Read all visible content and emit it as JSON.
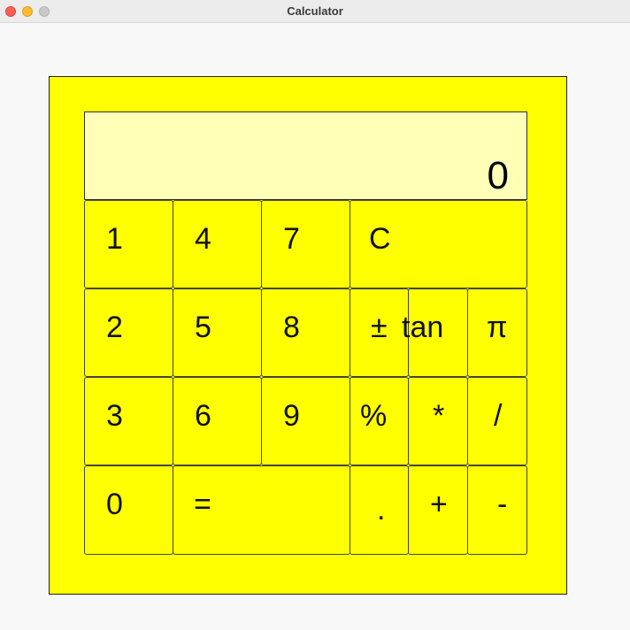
{
  "window": {
    "title": "Calculator"
  },
  "display": {
    "value": "0"
  },
  "keys": {
    "k1": "1",
    "k4": "4",
    "k7": "7",
    "clear": "C",
    "k2": "2",
    "k5": "5",
    "k8": "8",
    "plus_minus": "±",
    "tan": "tan",
    "pi": "π",
    "k3": "3",
    "k6": "6",
    "k9": "9",
    "percent": "%",
    "multiply": "*",
    "divide": "/",
    "k0": "0",
    "equals": "=",
    "decimal": ".",
    "add": "+",
    "subtract": "-"
  },
  "colors": {
    "panel": "#ffff00",
    "display": "#ffffb8",
    "button": "#ffff00"
  }
}
